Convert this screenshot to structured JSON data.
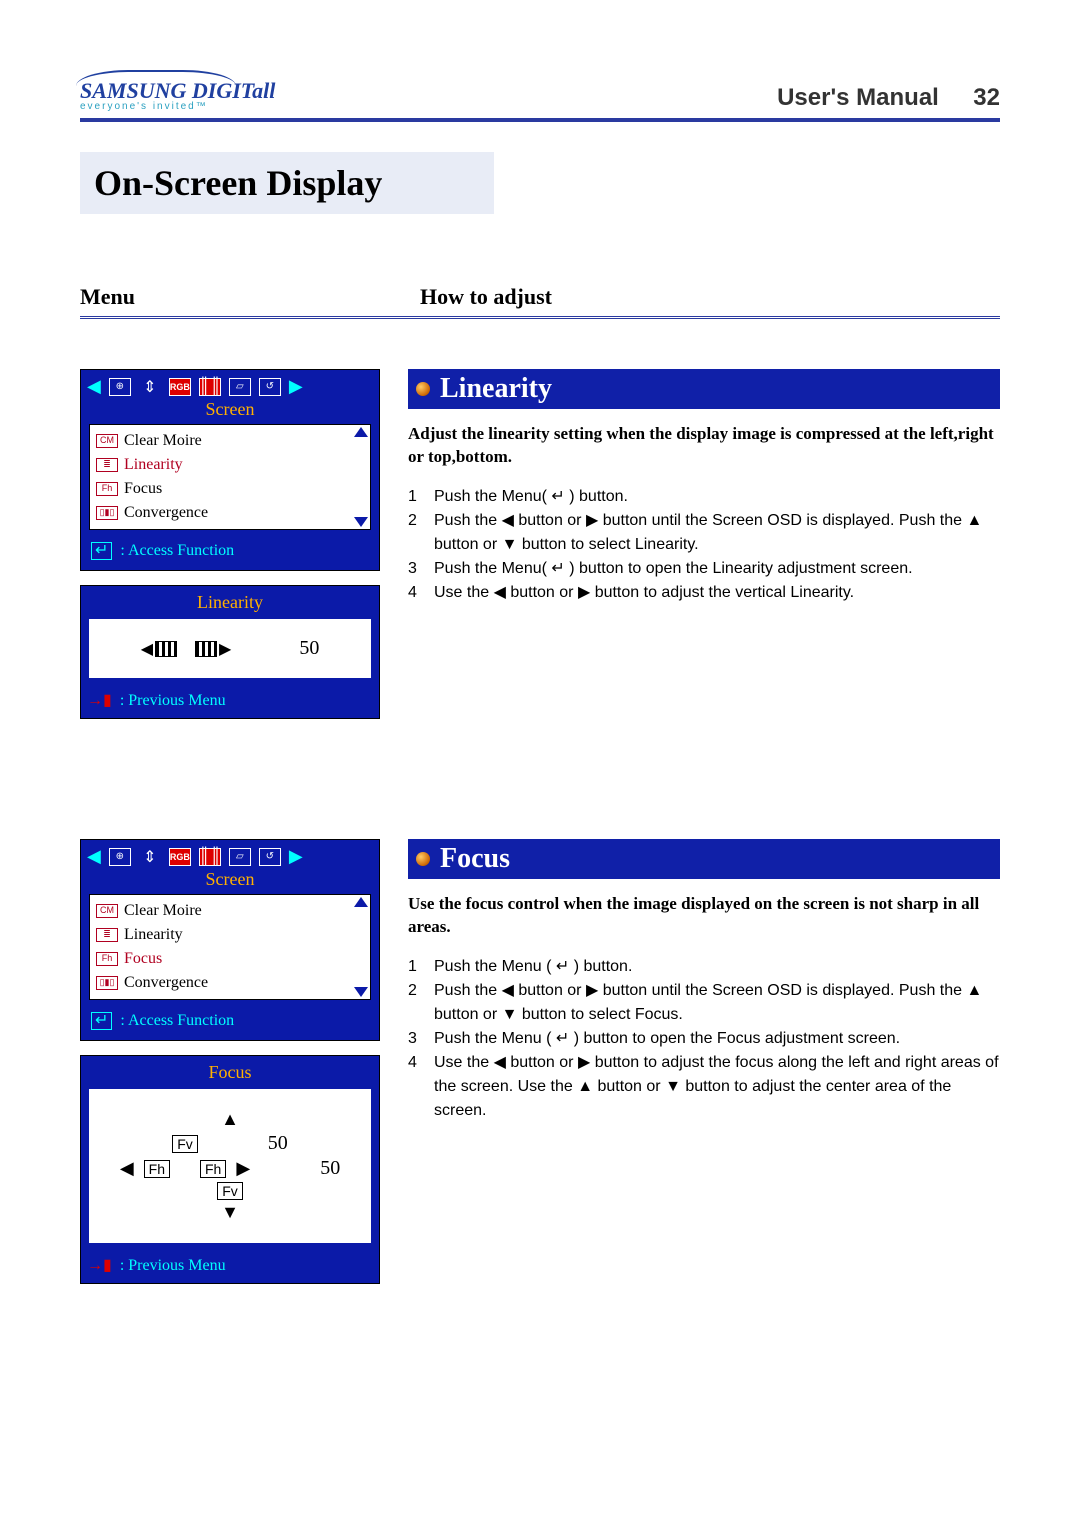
{
  "logo": {
    "brand": "SAMSUNG DIGITall",
    "tagline": "everyone's invited™"
  },
  "header": {
    "title": "User's Manual",
    "page": "32"
  },
  "section_title": "On-Screen Display",
  "columns": {
    "menu": "Menu",
    "how": "How to adjust"
  },
  "osd_common": {
    "tab_label": "Screen",
    "rgb_label": "RGB",
    "access_function": ": Access Function",
    "previous_menu": ": Previous Menu",
    "enter_symbol": "↵"
  },
  "entries": [
    {
      "key": "linearity",
      "menu_items": [
        {
          "icon": "CM",
          "label": "Clear Moire",
          "selected": false
        },
        {
          "icon": "≣",
          "label": "Linearity",
          "selected": true
        },
        {
          "icon": "Fh",
          "label": "Focus",
          "selected": false
        },
        {
          "icon": "▯▮▯",
          "label": "Convergence",
          "selected": false
        }
      ],
      "adjust_title": "Linearity",
      "adjust_value": "50",
      "title": "Linearity",
      "description": "Adjust the linearity setting when the display image is compressed at the left,right or top,bottom.",
      "steps": [
        "Push the Menu( ↵ ) button.",
        "Push the ◀ button or ▶ button until the Screen OSD is displayed. Push the ▲ button or ▼ button to select Linearity.",
        "Push the Menu( ↵ ) button to open the Linearity adjustment screen.",
        "Use the ◀ button or ▶ button to adjust the vertical Linearity."
      ]
    },
    {
      "key": "focus",
      "menu_items": [
        {
          "icon": "CM",
          "label": "Clear Moire",
          "selected": false
        },
        {
          "icon": "≣",
          "label": "Linearity",
          "selected": false
        },
        {
          "icon": "Fh",
          "label": "Focus",
          "selected": true
        },
        {
          "icon": "▯▮▯",
          "label": "Convergence",
          "selected": false
        }
      ],
      "adjust_title": "Focus",
      "adjust_values": {
        "fv": "50",
        "fh": "50"
      },
      "labels": {
        "fv": "Fv",
        "fh": "Fh"
      },
      "title": "Focus",
      "description": "Use the focus control when the image displayed on the screen is not sharp in all areas.",
      "steps": [
        "Push the Menu ( ↵ ) button.",
        "Push the ◀ button or ▶ button until the Screen OSD is displayed. Push the ▲ button or ▼ button to select Focus.",
        "Push the Menu ( ↵ ) button to open the Focus adjustment screen.",
        "Use the ◀ button or ▶ button to adjust the focus along the left and right areas of the screen. Use the ▲ button or ▼ button to adjust the center area of the screen."
      ]
    }
  ]
}
